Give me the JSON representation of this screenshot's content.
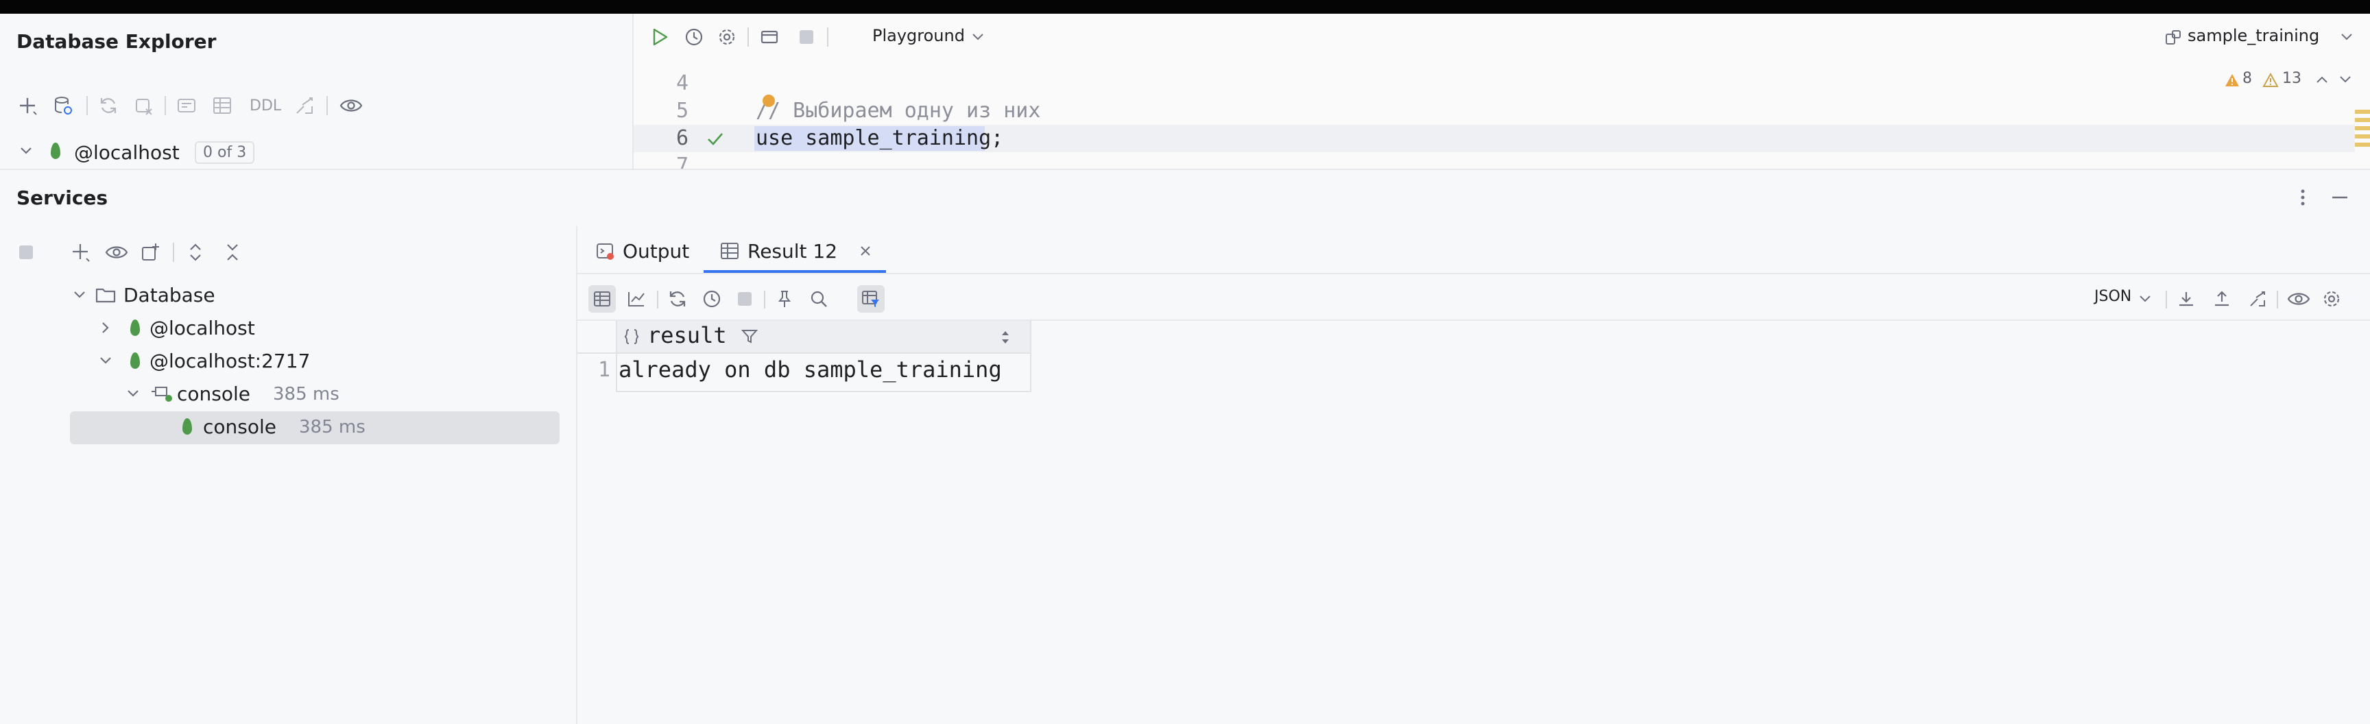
{
  "db_explorer": {
    "title": "Database Explorer",
    "toolbar_ddl": "DDL",
    "host": "@localhost",
    "host_badge": "0 of 3"
  },
  "editor": {
    "run_config": "Playground",
    "datasource": "sample_training",
    "warnings_count": "8",
    "weak_warnings_count": "13",
    "lines": [
      {
        "num": "4",
        "text": ""
      },
      {
        "num": "5",
        "text": "// Выбираем одну из них"
      },
      {
        "num": "6",
        "text": "use sample_training;"
      },
      {
        "num": "7",
        "text": ""
      }
    ]
  },
  "services": {
    "title": "Services",
    "tree": {
      "database": "Database",
      "host1": "@localhost",
      "host2": "@localhost:2717",
      "console_group": "console",
      "console_group_time": "385 ms",
      "console_leaf": "console",
      "console_leaf_time": "385 ms"
    }
  },
  "results": {
    "tabs": [
      {
        "label": "Output"
      },
      {
        "label": "Result 12"
      }
    ],
    "format": "JSON",
    "column": "result",
    "rows": [
      {
        "num": "1",
        "value": "already on db sample_training"
      }
    ]
  },
  "colors": {
    "accent": "#3574f0",
    "run_green": "#4e9a4a",
    "selection": "#d5dcf5",
    "warning": "#e8a33d"
  }
}
